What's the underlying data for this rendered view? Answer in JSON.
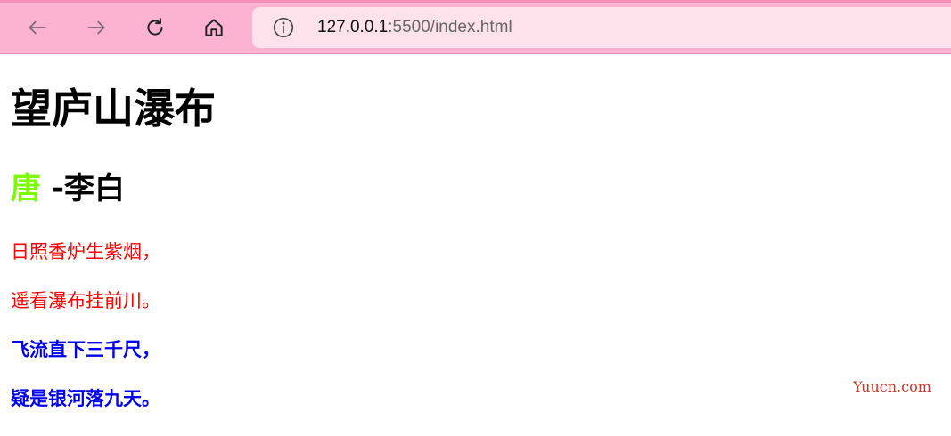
{
  "browser": {
    "url_host": "127.0.0.1",
    "url_rest": ":5500/index.html",
    "icons": {
      "back": "arrow-left-icon",
      "forward": "arrow-right-icon",
      "reload": "reload-icon",
      "home": "home-icon",
      "site_info": "info-icon"
    },
    "colors": {
      "toolbar": "#fbb3cf",
      "address_bar": "#fde1eb"
    }
  },
  "page": {
    "title": "望庐山瀑布",
    "dynasty": "唐",
    "author": " -李白",
    "lines": [
      "日照香炉生紫烟，",
      "遥看瀑布挂前川。",
      "飞流直下三千尺，",
      "疑是银河落九天。"
    ],
    "colors": {
      "dynasty": "#7cfc00",
      "red_lines": "#ff0000",
      "blue_lines": "#0000ee"
    }
  },
  "watermark": "Yuucn.com"
}
